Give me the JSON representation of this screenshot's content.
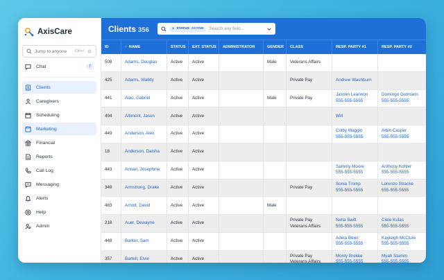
{
  "app": {
    "name": "AxisCare"
  },
  "sidebar": {
    "jump_placeholder": "Jump to anyone",
    "jump_shortcut": "Ctrl+/",
    "chat": {
      "label": "Chat",
      "badge": "7"
    },
    "items": [
      {
        "label": "Clients",
        "icon": "client-icon",
        "active": true
      },
      {
        "label": "Caregivers",
        "icon": "caregiver-icon"
      },
      {
        "label": "Scheduling",
        "icon": "calendar-icon"
      },
      {
        "label": "Marketing",
        "icon": "marketing-icon"
      },
      {
        "label": "Financial",
        "icon": "bank-icon"
      },
      {
        "label": "Reports",
        "icon": "report-icon"
      },
      {
        "label": "Call Log",
        "icon": "phone-icon"
      },
      {
        "label": "Messaging",
        "icon": "message-icon"
      },
      {
        "label": "Alerts",
        "icon": "bell-icon"
      },
      {
        "label": "Help",
        "icon": "help-icon"
      },
      {
        "label": "Admin",
        "icon": "admin-icon"
      }
    ]
  },
  "header": {
    "title": "Clients",
    "count": "356",
    "filter_chip": {
      "label": "STATUS",
      "value": "ACTIVE"
    },
    "search_placeholder": "Search any field..."
  },
  "table": {
    "columns": [
      "ID",
      "NAME",
      "STATUS",
      "EXT. STATUS",
      "ADMINISTRATOR",
      "GENDER",
      "CLASS",
      "RESP. PARTY #1",
      "RESP. PARTY #2"
    ],
    "rows": [
      {
        "id": "508",
        "name": "Adams, Douglas",
        "status": "Active",
        "ext": "Active",
        "admin": "",
        "gender": "Male",
        "class": [
          "Veterans Affairs"
        ],
        "p1": [],
        "p2": []
      },
      {
        "id": "425",
        "name": "Adams, Walldy",
        "status": "Active",
        "ext": "Active",
        "admin": "",
        "gender": "",
        "class": [
          "Private Pay"
        ],
        "p1": [
          "Andrew Washburn"
        ],
        "p2": []
      },
      {
        "id": "441",
        "name": "Alao, Gabriel",
        "status": "Active",
        "ext": "Active",
        "admin": "",
        "gender": "Male",
        "class": [
          "Private Pay"
        ],
        "p1": [
          "Jasmin Leannon",
          "555-555-5555"
        ],
        "p2": [
          "Domingo Gutmann",
          "555-555-5555"
        ]
      },
      {
        "id": "494",
        "name": "Altimont, Jason",
        "status": "Active",
        "ext": "Active",
        "admin": "",
        "gender": "",
        "class": [],
        "p1": [
          "Will"
        ],
        "p2": []
      },
      {
        "id": "449",
        "name": "Anderson, Alex",
        "status": "Active",
        "ext": "Active",
        "admin": "",
        "gender": "",
        "class": [],
        "p1": [
          "Colby Maggio",
          "555-555-5555"
        ],
        "p2": [
          "Albin Casper",
          "555-555-5555"
        ]
      },
      {
        "id": "18",
        "name": "Anderson, Daisha",
        "status": "Active",
        "ext": "Active",
        "admin": "",
        "gender": "",
        "class": [],
        "p1": [],
        "p2": []
      },
      {
        "id": "443",
        "name": "Annan, Josephine",
        "status": "Active",
        "ext": "Active",
        "admin": "",
        "gender": "",
        "class": [],
        "p1": [
          "Sammy Moore",
          "555-555-5555"
        ],
        "p2": [
          "Anthony Kohler",
          "555-555-5555"
        ]
      },
      {
        "id": "349",
        "name": "Armstrong, Drake",
        "status": "Active",
        "ext": "Active",
        "admin": "",
        "gender": "",
        "class": [
          "Private Pay"
        ],
        "p1": [
          "Sonia Tromp",
          "555-555-5555"
        ],
        "p2": [
          "Lorenzo Stracke",
          "555-555-5555"
        ]
      },
      {
        "id": "483",
        "name": "Arnott, David",
        "status": "Active",
        "ext": "Active",
        "admin": "",
        "gender": "Male",
        "class": [],
        "p1": [],
        "p2": []
      },
      {
        "id": "218",
        "name": "Auer, Dewayne",
        "status": "Active",
        "ext": "Active",
        "admin": "",
        "gender": "",
        "class": [
          "Private Pay",
          "Veterans Affairs"
        ],
        "p1": [
          "Nella Swift",
          "555-555-5555"
        ],
        "p2": [
          "Cielo Kulas",
          "555-555-5555"
        ]
      },
      {
        "id": "448",
        "name": "Barker, Sam",
        "status": "Active",
        "ext": "Active",
        "admin": "",
        "gender": "",
        "class": [],
        "p1": [
          "Adela Beier",
          "555-555-5555"
        ],
        "p2": [
          "Kayleigh McClure",
          "555-555-5555"
        ]
      },
      {
        "id": "357",
        "name": "Bartell, Elvie",
        "status": "Active",
        "ext": "Active",
        "admin": "",
        "gender": "",
        "class": [
          "Private Pay",
          "Veterans Affairs"
        ],
        "p1": [
          "Monty Brekke",
          "555-555-5555"
        ],
        "p2": [
          "Myah Stamm",
          "555-555-5555"
        ]
      }
    ]
  },
  "colors": {
    "brand_blue": "#1f6fd8",
    "link_blue": "#1f63c9",
    "logo_orange": "#f5a623"
  }
}
